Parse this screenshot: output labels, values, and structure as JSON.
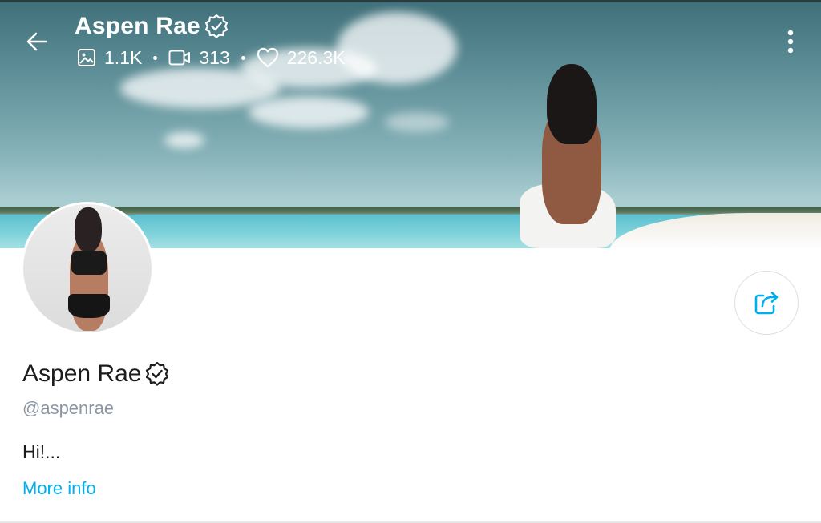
{
  "header": {
    "name": "Aspen Rae",
    "stats": {
      "photos": "1.1K",
      "videos": "313",
      "likes": "226.3K"
    }
  },
  "profile": {
    "name": "Aspen Rae",
    "handle": "@aspenrae",
    "bio": "Hi!...",
    "more_info_label": "More info"
  },
  "icons": {
    "back": "arrow-left-icon",
    "verified": "verified-badge-icon",
    "photos": "image-icon",
    "videos": "video-camera-icon",
    "likes": "heart-icon",
    "menu": "vertical-dots-icon",
    "share": "share-icon"
  },
  "colors": {
    "accent": "#00aff0",
    "muted": "#8a96a3",
    "text": "#1b1b1b"
  }
}
